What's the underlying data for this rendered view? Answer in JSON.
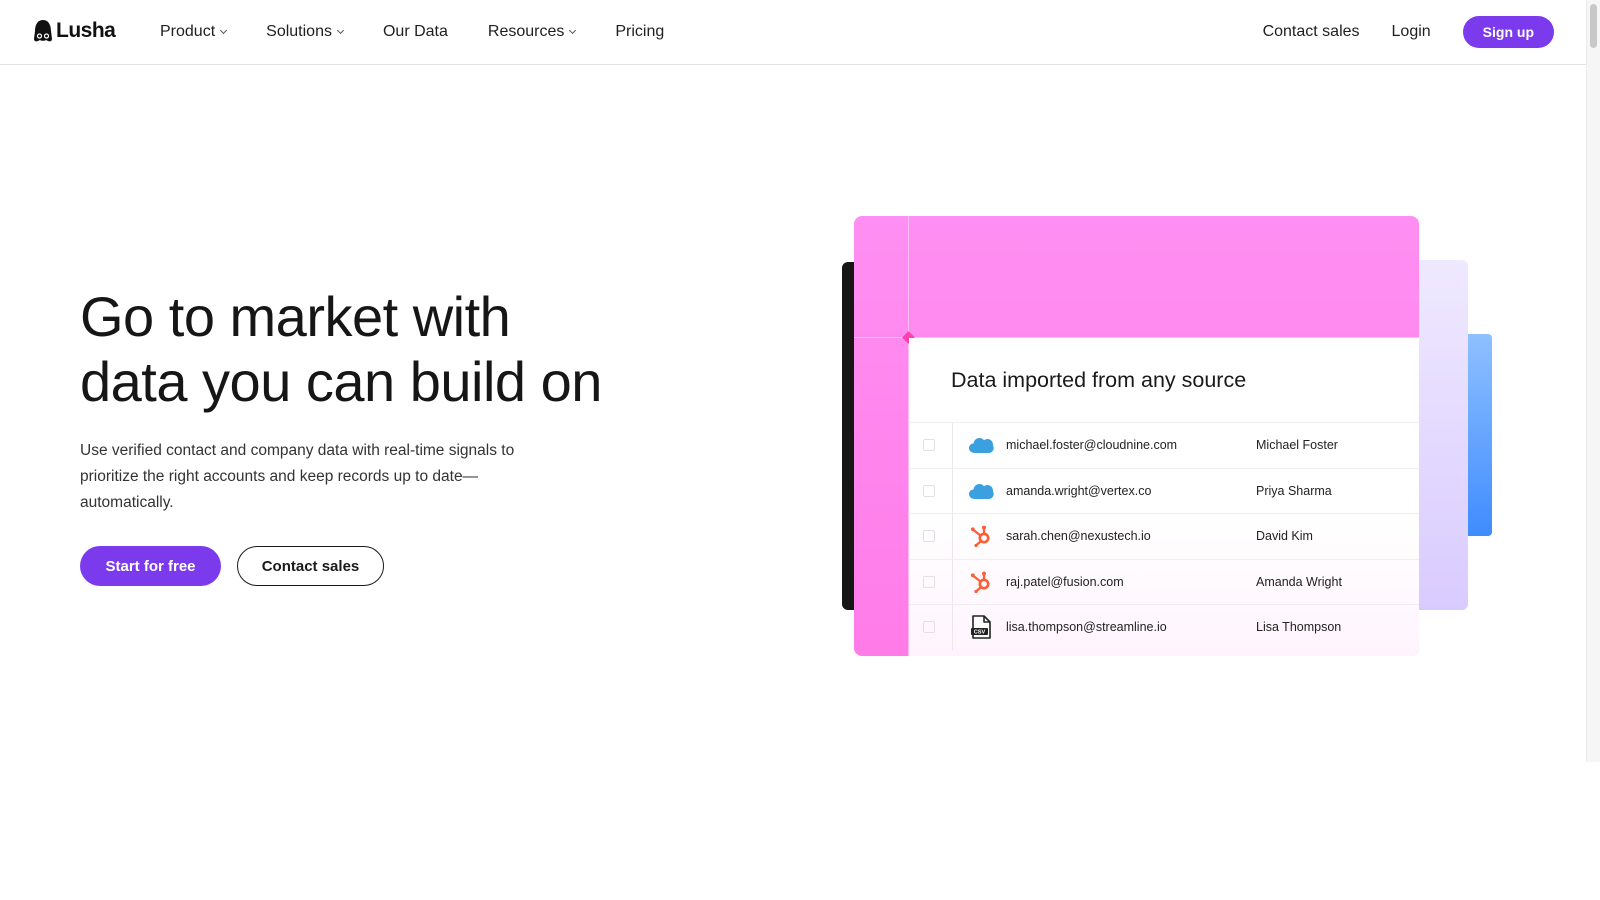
{
  "header": {
    "logo_text": "Lusha",
    "nav": [
      {
        "label": "Product",
        "has_dropdown": true
      },
      {
        "label": "Solutions",
        "has_dropdown": true
      },
      {
        "label": "Our Data",
        "has_dropdown": false
      },
      {
        "label": "Resources",
        "has_dropdown": true
      },
      {
        "label": "Pricing",
        "has_dropdown": false
      }
    ],
    "contact_sales": "Contact sales",
    "login": "Login",
    "signup": "Sign up"
  },
  "hero": {
    "title_line1": "Go to market with",
    "title_line2": "data you can build on",
    "subtitle": "Use verified contact and company data with real-time signals to prioritize the right accounts and keep records up to date—automatically.",
    "primary_cta": "Start for free",
    "secondary_cta": "Contact sales"
  },
  "illustration": {
    "panel_title": "Data imported from any source",
    "rows": [
      {
        "source_icon": "salesforce-icon",
        "email": "michael.foster@cloudnine.com",
        "name": "Michael Foster"
      },
      {
        "source_icon": "salesforce-icon",
        "email": "amanda.wright@vertex.co",
        "name": "Priya Sharma"
      },
      {
        "source_icon": "hubspot-icon",
        "email": "sarah.chen@nexustech.io",
        "name": "David Kim"
      },
      {
        "source_icon": "hubspot-icon",
        "email": "raj.patel@fusion.com",
        "name": "Amanda Wright"
      },
      {
        "source_icon": "csv-file-icon",
        "email": "lisa.thompson@streamline.io",
        "name": "Lisa Thompson"
      }
    ],
    "csv_label": "CSV"
  },
  "colors": {
    "accent": "#7c3aed",
    "card_pink": "#ff86ef",
    "salesforce_blue": "#3ba0e0",
    "hubspot_orange": "#ff5c35"
  }
}
